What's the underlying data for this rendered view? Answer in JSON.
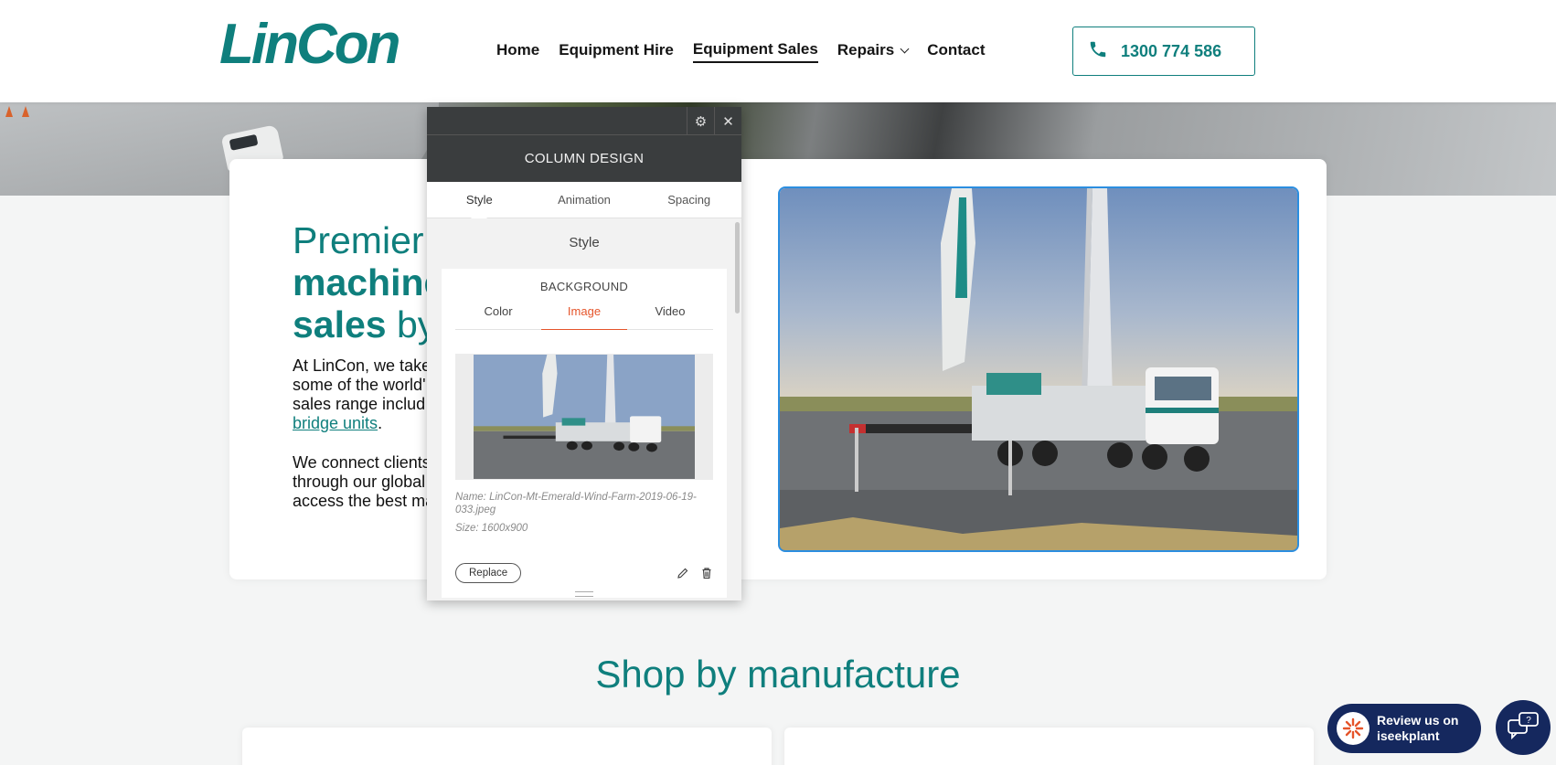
{
  "header": {
    "logo_text": "LinCon",
    "nav": [
      {
        "label": "Home"
      },
      {
        "label": "Equipment Hire"
      },
      {
        "label": "Equipment Sales"
      },
      {
        "label": "Repairs"
      },
      {
        "label": "Contact"
      }
    ],
    "phone": "1300 774 586"
  },
  "intro": {
    "headline_line1": "Premier",
    "headline_bold2": "machine",
    "headline_bold3": "sales",
    "headline_rest3": " by",
    "p1_line1": "At LinCon, we take",
    "p1_line2": "some of the world'",
    "p1_line3": "sales range includ",
    "p1_link": "bridge units",
    "p1_end": ".",
    "p2_line1": "We connect clients",
    "p2_line2": "through our global",
    "p2_line3": "access the best ma"
  },
  "panel": {
    "title": "COLUMN DESIGN",
    "tabs": [
      "Style",
      "Animation",
      "Spacing"
    ],
    "active_tab": "Style",
    "section_title": "Style",
    "background_title": "BACKGROUND",
    "bg_tabs": [
      "Color",
      "Image",
      "Video"
    ],
    "active_bg_tab": "Image",
    "image_name": "Name: LinCon-Mt-Emerald-Wind-Farm-2019-06-19-033.jpeg",
    "image_size": "Size: 1600x900",
    "replace_label": "Replace"
  },
  "shop": {
    "title": "Shop by manufacture"
  },
  "widgets": {
    "review_line1": "Review us on",
    "review_line2": "iseekplant"
  },
  "colors": {
    "brand_teal": "#0f7f7d",
    "panel_dark": "#3a3d3e",
    "accent_orange": "#e5542a",
    "selection_blue": "#2b8ee0",
    "widget_navy": "#15285e"
  }
}
